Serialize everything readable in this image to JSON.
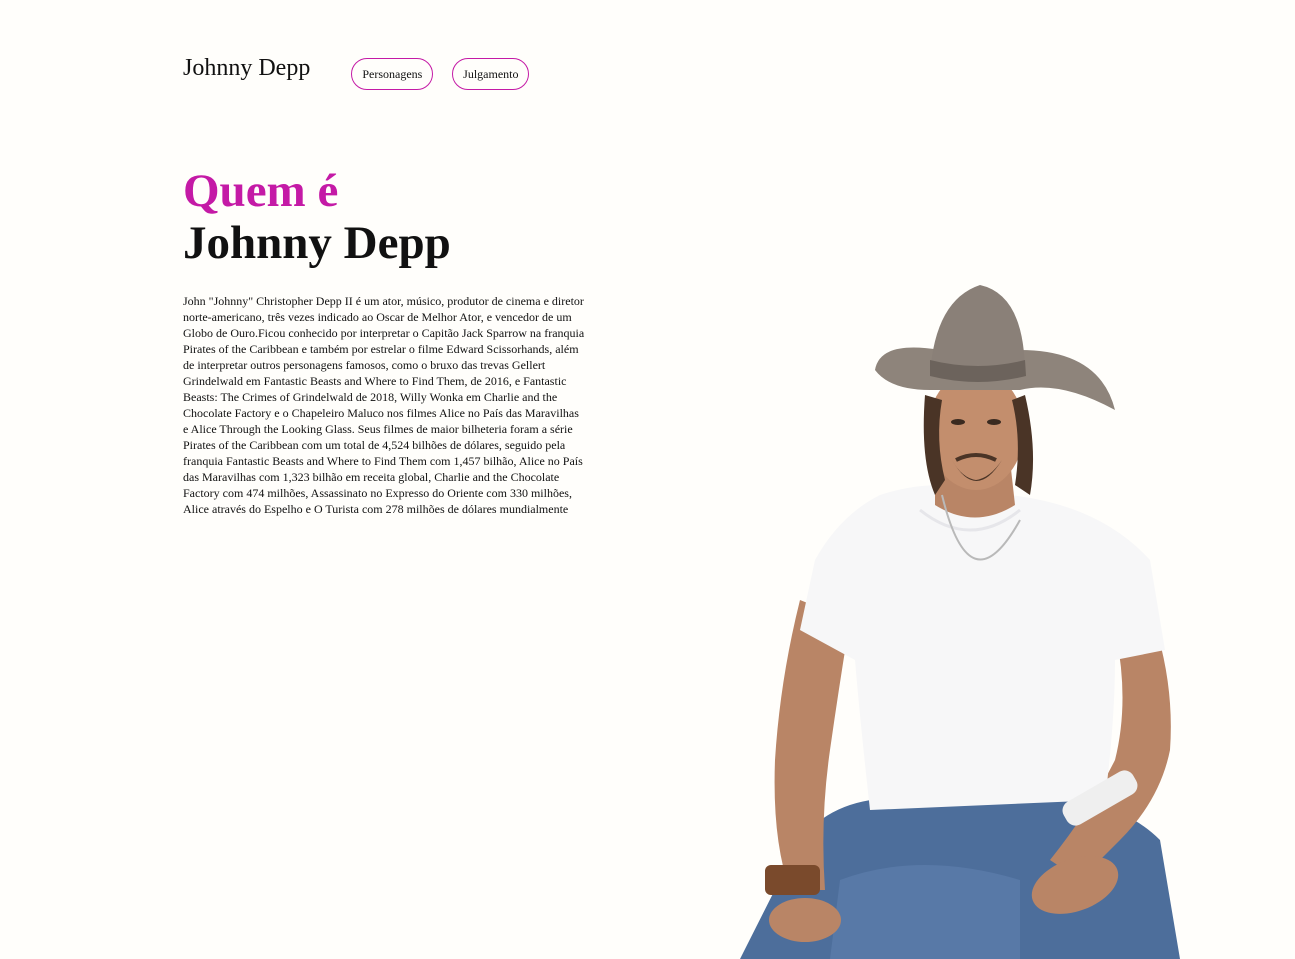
{
  "header": {
    "brand": "Johnny Depp",
    "nav": [
      {
        "label": "Personagens"
      },
      {
        "label": "Julgamento"
      }
    ]
  },
  "hero": {
    "title_line1": "Quem é",
    "title_line2": "Johnny Depp",
    "bio": "John \"Johnny\" Christopher Depp II é um ator, músico, produtor de cinema e diretor norte-americano, três vezes indicado ao Oscar de Melhor Ator, e vencedor de um Globo de Ouro.Ficou conhecido por interpretar o Capitão Jack Sparrow na franquia Pirates of the Caribbean e também por estrelar o filme Edward Scissorhands, além de interpretar outros personagens famosos, como o bruxo das trevas Gellert Grindelwald em Fantastic Beasts and Where to Find Them, de 2016, e Fantastic Beasts: The Crimes of Grindelwald de 2018, Willy Wonka em Charlie and the Chocolate Factory e o Chapeleiro Maluco nos filmes Alice no País das Maravilhas e Alice Through the Looking Glass. Seus filmes de maior bilheteria foram a série Pirates of the Caribbean com um total de 4,524 bilhões de dólares, seguido pela franquia Fantastic Beasts and Where to Find Them com 1,457 bilhão, Alice no País das Maravilhas com 1,323 bilhão em receita global, Charlie and the Chocolate Factory com 474 milhões, Assassinato no Expresso do Oriente com 330 milhões, Alice através do Espelho e O Turista com 278 milhões de dólares mundialmente"
  },
  "colors": {
    "accent": "#c41aa6",
    "background": "#fffefb",
    "text": "#111111"
  }
}
